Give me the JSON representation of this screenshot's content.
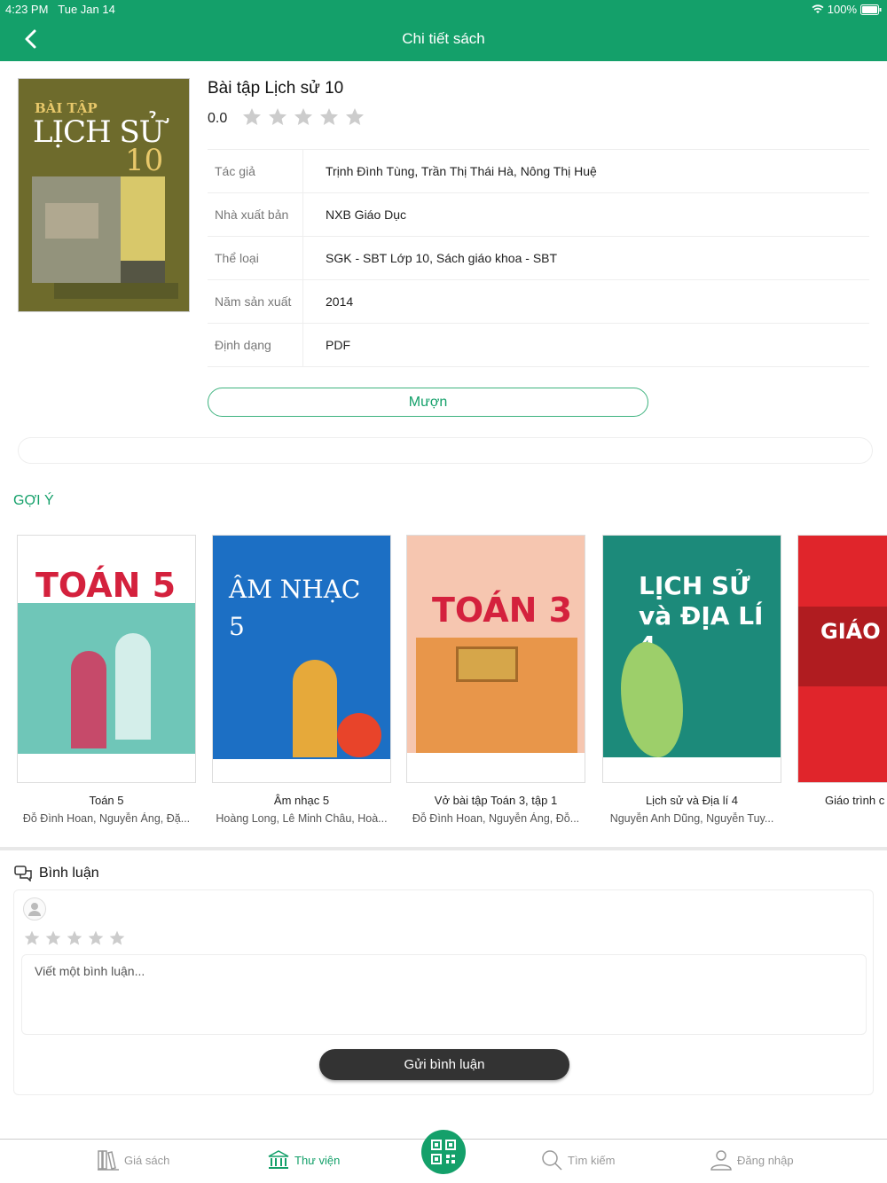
{
  "status": {
    "time": "4:23 PM",
    "date": "Tue Jan 14",
    "battery": "100%"
  },
  "header": {
    "title": "Chi tiết sách"
  },
  "book": {
    "title": "Bài tập Lịch sử 10",
    "rating": "0.0",
    "cover": {
      "line1": "BÀI TẬP",
      "line2": "LỊCH SỬ",
      "line3": "10"
    },
    "details": [
      {
        "label": "Tác giả",
        "value": "Trịnh Đình Tùng, Trần Thị Thái Hà, Nông Thị Huệ"
      },
      {
        "label": "Nhà xuất bản",
        "value": "NXB Giáo Dục"
      },
      {
        "label": "Thể loại",
        "value": "SGK - SBT  Lớp 10, Sách giáo khoa - SBT"
      },
      {
        "label": "Năm sản xuất",
        "value": "2014"
      },
      {
        "label": "Định dạng",
        "value": "PDF"
      }
    ],
    "borrow_label": "Mượn"
  },
  "suggest": {
    "label": "GỢI Ý",
    "items": [
      {
        "title": "Toán 5",
        "authors": "Đỗ Đình Hoan, Nguyễn Áng, Đặ...",
        "cover_text": "TOÁN 5",
        "cover_color": "#5bbfb0"
      },
      {
        "title": "Âm nhạc 5",
        "authors": "Hoàng Long, Lê Minh Châu, Hoà...",
        "cover_text": "ÂM NHẠC 5",
        "cover_color": "#1c6fc4"
      },
      {
        "title": "Vở bài tập Toán 3, tập 1",
        "authors": "Đỗ Đình Hoan, Nguyễn Áng, Đỗ...",
        "cover_text": "TOÁN 3",
        "cover_color": "#f6c6b0"
      },
      {
        "title": "Lịch sử và Địa lí 4",
        "authors": "Nguyễn Anh Dũng, Nguyễn Tuy...",
        "cover_text": "LỊCH SỬ và ĐỊA LÍ 4",
        "cover_color": "#1c8a7a"
      },
      {
        "title": "Giáo trình c",
        "authors": "",
        "cover_text": "GIÁO QUẢN T",
        "cover_color": "#e0252b"
      }
    ]
  },
  "comments": {
    "title": "Bình luận",
    "placeholder": "Viết một bình luận...",
    "send_label": "Gửi bình luận"
  },
  "tabs": [
    {
      "label": "Giá sách",
      "icon": "bookshelf-icon"
    },
    {
      "label": "Thư viện",
      "icon": "library-icon"
    },
    {
      "label": "Tìm kiếm",
      "icon": "search-icon"
    },
    {
      "label": "Đăng nhập",
      "icon": "user-icon"
    }
  ],
  "colors": {
    "accent": "#14a06a",
    "dark_button": "#333333"
  }
}
